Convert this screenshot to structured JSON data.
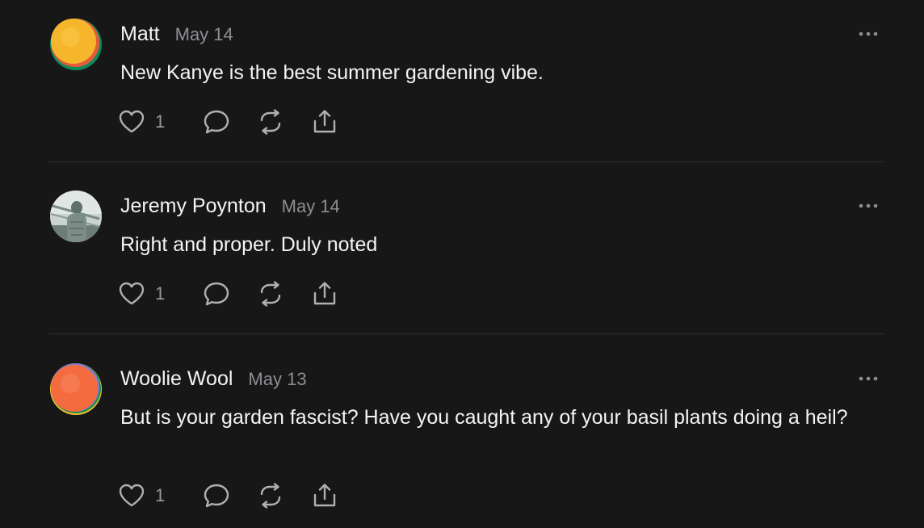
{
  "comments": [
    {
      "name": "Matt",
      "date": "May 14",
      "text": "New Kanye is the best summer gardening vibe.",
      "likes": "1",
      "avatar": {
        "type": "gradient",
        "primary": "#f5b62c",
        "secondary": "#0f8a5a",
        "accent": "#e45b3a"
      }
    },
    {
      "name": "Jeremy Poynton",
      "date": "May 14",
      "text": "Right and proper. Duly noted",
      "likes": "1",
      "avatar": {
        "type": "photo",
        "primary": "#7c8d86",
        "secondary": "#c9d3cf",
        "accent": "#4f5e59"
      }
    },
    {
      "name": "Woolie Wool",
      "date": "May 13",
      "text": "But is your garden fascist? Have you caught any of your basil plants doing a heil?",
      "likes": "1",
      "avatar": {
        "type": "gradient",
        "primary": "#f46b40",
        "secondary": "#1b8a4f",
        "accent": "#f2c230"
      }
    }
  ],
  "icons": {
    "like": "heart-icon",
    "reply": "comment-bubble-icon",
    "restack": "restack-icon",
    "share": "share-icon",
    "more": "more-options-icon"
  },
  "colors": {
    "background": "#171718",
    "text": "#f4f4f4",
    "muted": "#8e8e93",
    "divider": "#2f2f31"
  }
}
